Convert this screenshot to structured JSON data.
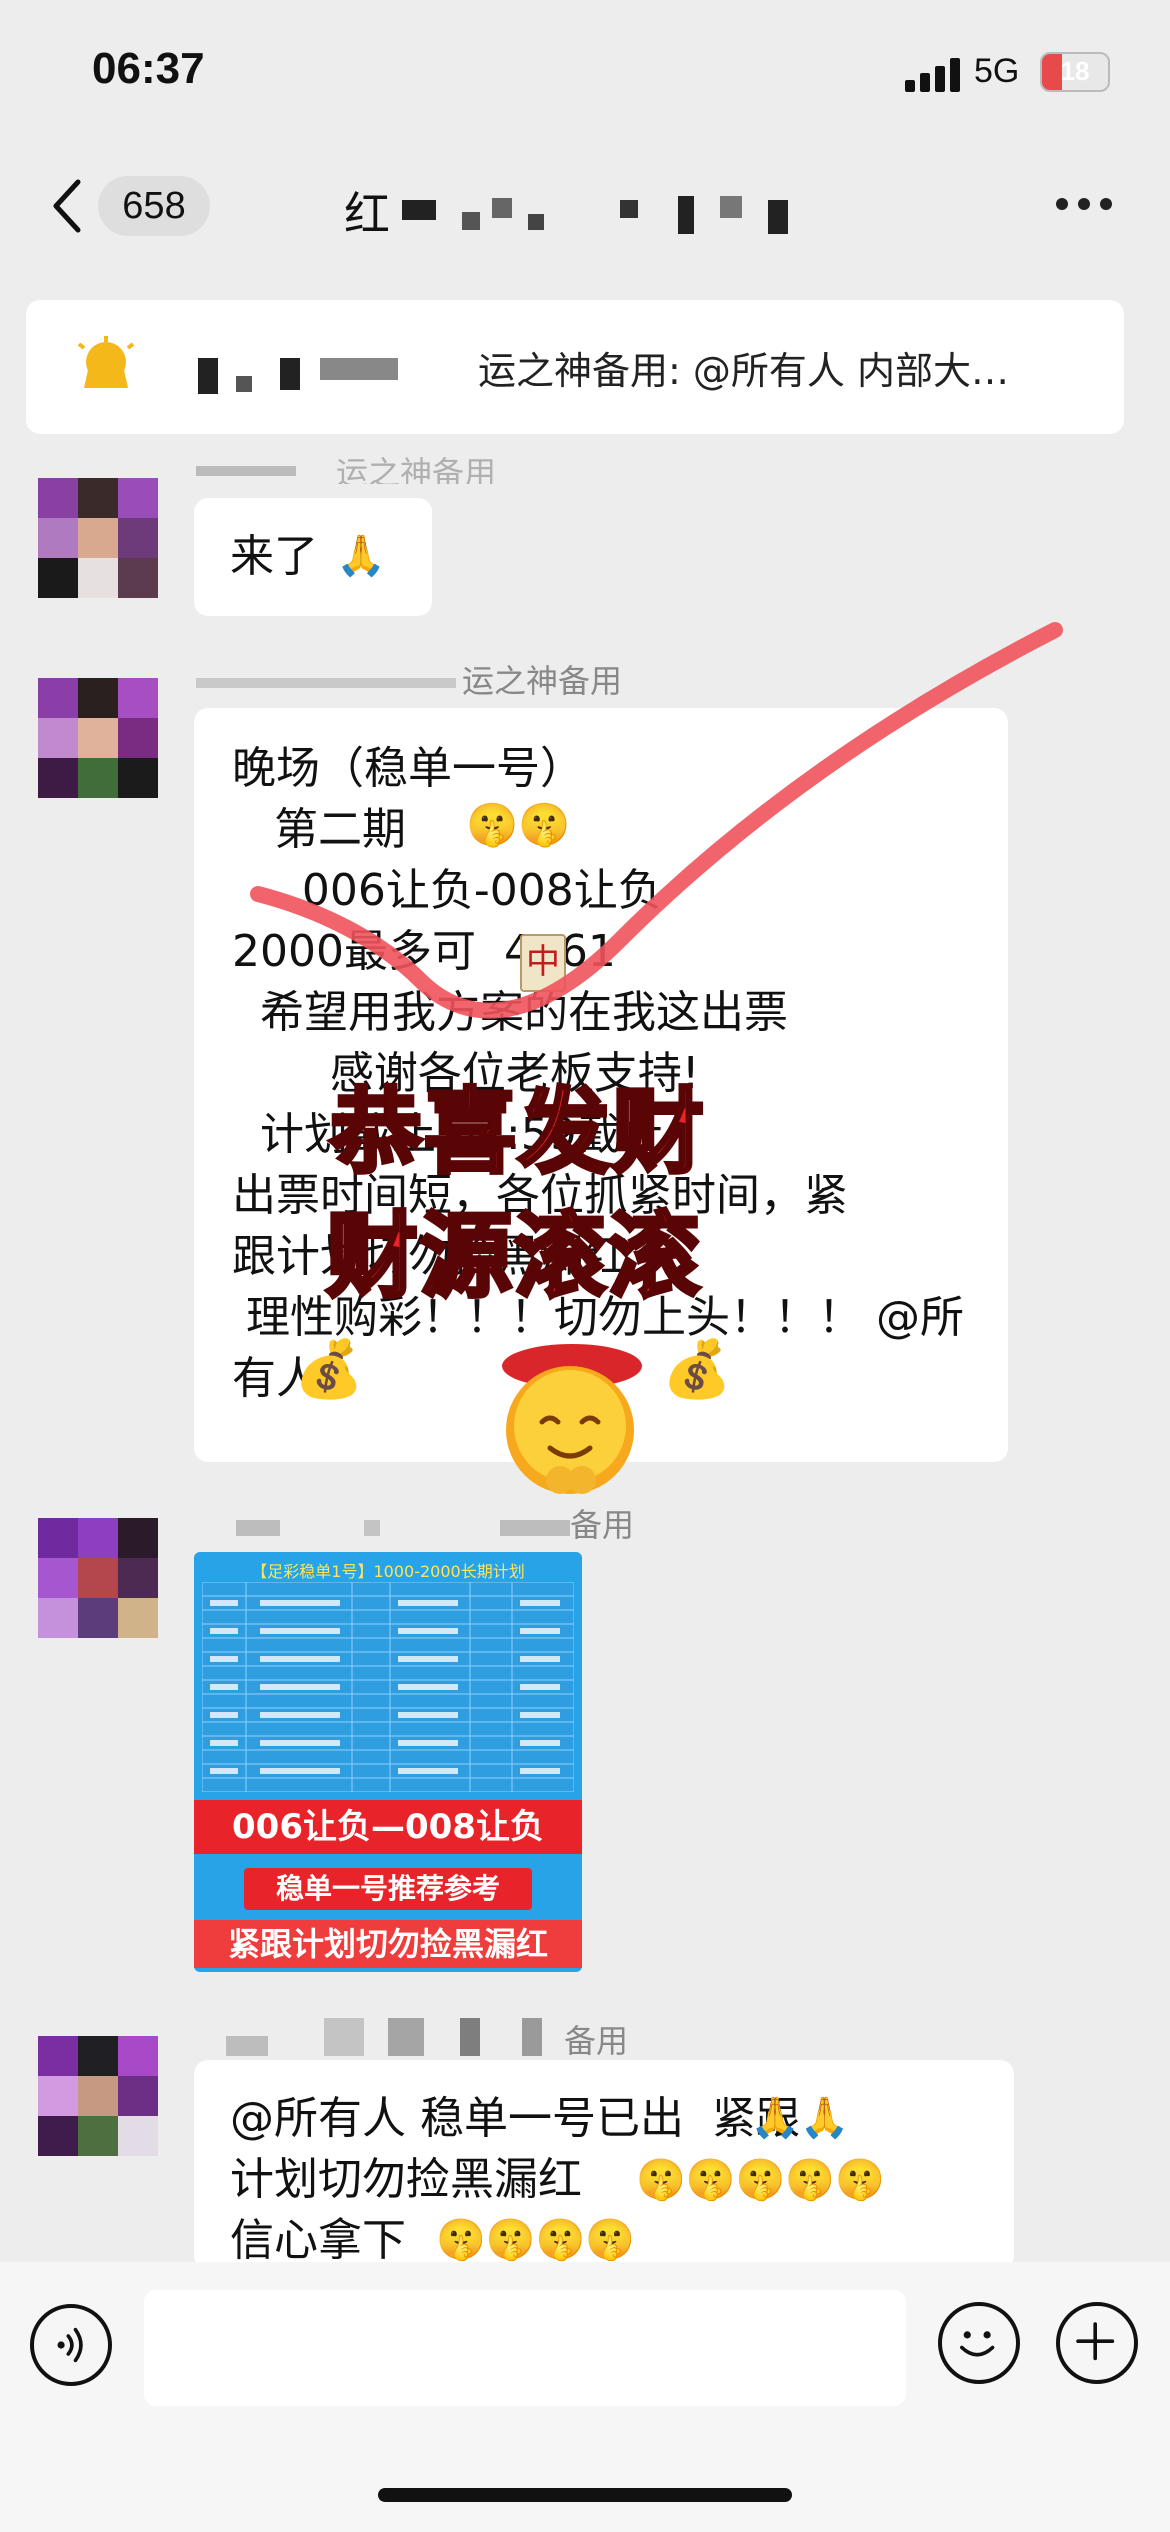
{
  "status_bar": {
    "time": "06:37",
    "network": "5G",
    "battery": "18"
  },
  "header": {
    "unread_count": "658",
    "title_visible": "红"
  },
  "pinned": {
    "text": "运之神备用: @所有人 内部大…"
  },
  "messages": [
    {
      "sender_visible": "运之神备用",
      "text": "来了"
    },
    {
      "sender_visible": "运之神备用",
      "lines": [
        "晚场（稳单一号）",
        "   第二期",
        "     006让负-008让负",
        "2000最多可  4461",
        "  希望用我方案的在我这出票",
        "       感谢各位老板支持!",
        "  计划截止  ·2:59截止",
        "出票时间短，各位抓紧时间，紧",
        "跟计划切勿捡黑漏红",
        " 理性购彩！！！切勿上头！！！ @所",
        "有人"
      ]
    },
    {
      "sender_visible": "备用",
      "image": {
        "title": "【足彩稳单1号】1000-2000长期计划",
        "band1": "006让负—008让负",
        "band2": "稳单一号推荐参考",
        "band3": "紧跟计划切勿捡黑漏红"
      }
    },
    {
      "sender_visible": "备用",
      "lines": [
        "@所有人 稳单一号已出  紧跟",
        "计划切勿捡黑漏红",
        "信心拿下"
      ]
    }
  ],
  "sticker": {
    "line1": "恭喜发财",
    "line2": "财源滚滚"
  },
  "icons": [
    "back-icon",
    "more-icon",
    "announcement-icon",
    "voice-icon",
    "emoji-icon",
    "plus-icon"
  ],
  "colors": {
    "accent_red": "#e8242a",
    "check_red": "#f0535c",
    "bubble": "#ffffff",
    "background": "#ededed"
  }
}
